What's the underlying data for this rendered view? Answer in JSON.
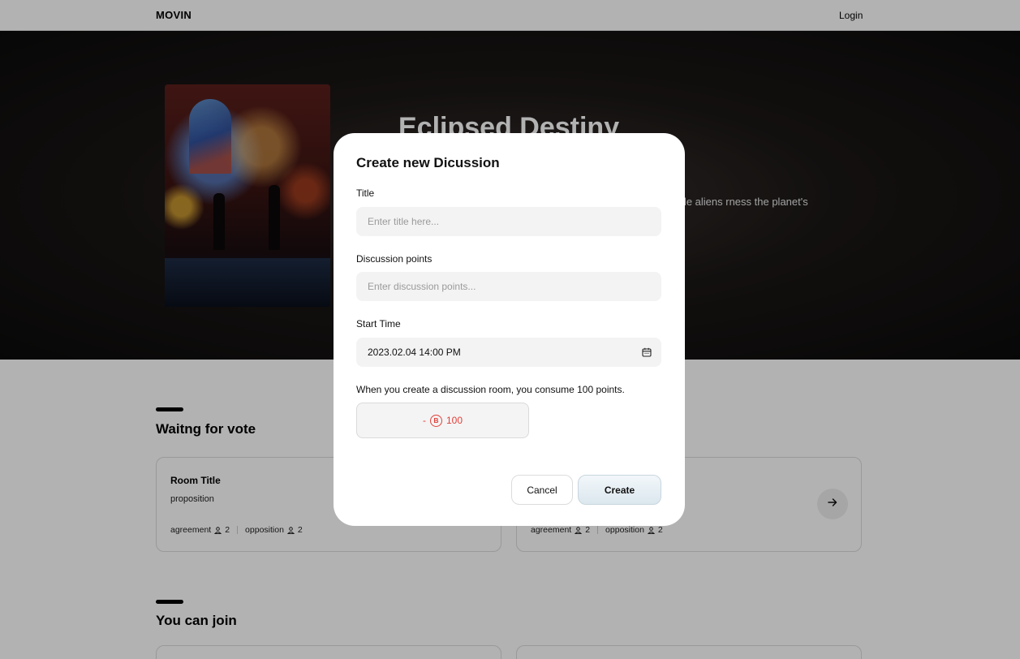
{
  "nav": {
    "logo": "MOVIN",
    "login_label": "Login"
  },
  "hero": {
    "title": "Eclipsed Destiny",
    "description": "leads an elite team on a perilous alvation. As they battle hostile aliens rness the planet's mysterious power bit it. \"Eclipsed Destiny\" is a gripping ture."
  },
  "sections": {
    "waiting_title": "Waitng for vote",
    "join_title": "You can join"
  },
  "rooms": [
    {
      "title": "Room Title",
      "proposition": "proposition",
      "agreement_label": "agreement",
      "agreement_count": "2",
      "opposition_label": "opposition",
      "opposition_count": "2"
    },
    {
      "title": "",
      "proposition": "",
      "agreement_label": "agreement",
      "agreement_count": "2",
      "opposition_label": "opposition",
      "opposition_count": "2"
    }
  ],
  "modal": {
    "title": "Create new Dicussion",
    "title_label": "Title",
    "title_placeholder": "Enter title here...",
    "points_label": "Discussion points",
    "points_placeholder": "Enter discussion points...",
    "start_label": "Start Time",
    "start_value": "2023.02.04 14:00 PM",
    "note": "When you create a discussion room, you consume 100 points.",
    "cost_prefix": "-",
    "coin_symbol": "B",
    "cost_value": "100",
    "cancel_label": "Cancel",
    "create_label": "Create"
  },
  "colors": {
    "accent_red": "#e0403a",
    "overlay": "rgba(0,0,0,0.30)"
  }
}
